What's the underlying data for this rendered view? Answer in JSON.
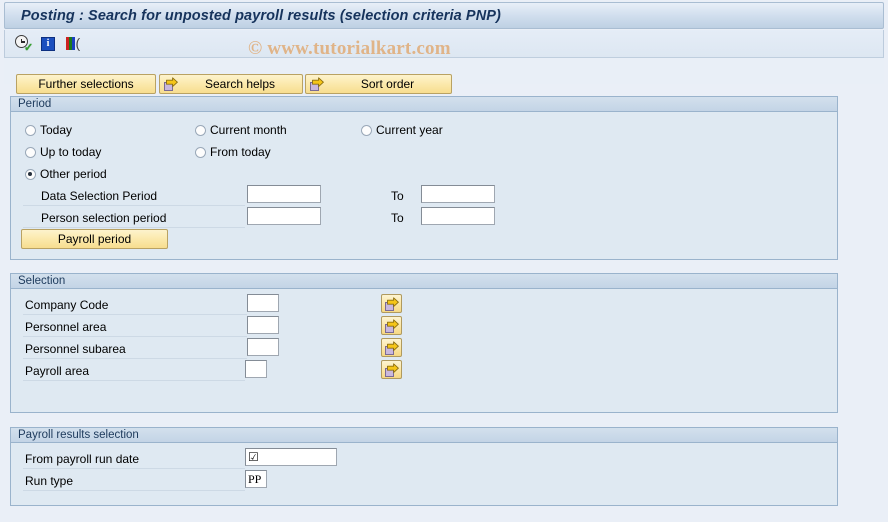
{
  "window": {
    "title": "Posting : Search for unposted payroll results (selection criteria PNP)"
  },
  "watermark": {
    "text": "© www.tutorialkart.com"
  },
  "toolbar": {
    "icons": [
      {
        "name": "execute-clock-icon",
        "glyph": "clock-check"
      },
      {
        "name": "information-icon",
        "glyph": "i"
      },
      {
        "name": "color-bars-icon",
        "glyph": "bars"
      }
    ]
  },
  "buttons": {
    "further_selections": "Further selections",
    "search_helps": "Search helps",
    "sort_order": "Sort order"
  },
  "period_panel": {
    "title": "Period",
    "radios": [
      {
        "label": "Today",
        "selected": false
      },
      {
        "label": "Current month",
        "selected": false
      },
      {
        "label": "Current year",
        "selected": false
      },
      {
        "label": "Up to today",
        "selected": false
      },
      {
        "label": "From today",
        "selected": false
      },
      {
        "label": "Other period",
        "selected": true
      }
    ],
    "fields": [
      {
        "label": "Data Selection Period",
        "value": "",
        "to_label": "To",
        "to_value": ""
      },
      {
        "label": "Person selection period",
        "value": "",
        "to_label": "To",
        "to_value": ""
      }
    ],
    "payroll_period_button": "Payroll period"
  },
  "selection_panel": {
    "title": "Selection",
    "fields": [
      {
        "label": "Company Code",
        "value": ""
      },
      {
        "label": "Personnel area",
        "value": ""
      },
      {
        "label": "Personnel subarea",
        "value": ""
      },
      {
        "label": "Payroll area",
        "value": ""
      }
    ],
    "multi_select_icon": "multiple-selection-arrow-icon"
  },
  "results_panel": {
    "title": "Payroll results selection",
    "fields": [
      {
        "label": "From payroll run date",
        "value": "☑"
      },
      {
        "label": "Run type",
        "value": "PP"
      }
    ]
  },
  "colors": {
    "title_text": "#16335c",
    "panel_bg": "#dfe9f2",
    "panel_border": "#9ab3cc",
    "button_yellow": "#fbe9ac",
    "watermark": "#e0b488"
  }
}
